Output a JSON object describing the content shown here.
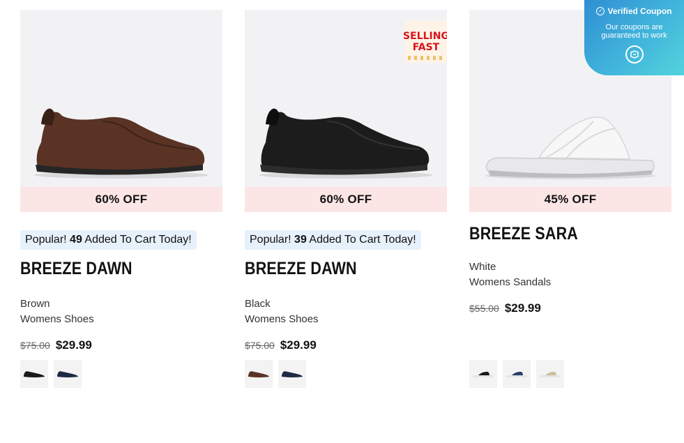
{
  "coupon": {
    "title": "Verified Coupon",
    "subtitle_line1": "Our coupons are",
    "subtitle_line2": "guaranteed to work",
    "check_icon": "check-circle-icon",
    "logo_icon": "coupon-logo-icon"
  },
  "products": [
    {
      "discount": "60% OFF",
      "popular_prefix": "Popular!",
      "popular_count": "49",
      "popular_suffix": "Added To Cart Today!",
      "name": "BREEZE DAWN",
      "color": "Brown",
      "category": "Womens Shoes",
      "old_price": "$75.00",
      "new_price": "$29.99",
      "shoe_color": "#5a3324",
      "swatches": [
        "black",
        "navy"
      ]
    },
    {
      "discount": "60% OFF",
      "popular_prefix": "Popular!",
      "popular_count": "39",
      "popular_suffix": "Added To Cart Today!",
      "name": "BREEZE DAWN",
      "color": "Black",
      "category": "Womens Shoes",
      "old_price": "$75.00",
      "new_price": "$29.99",
      "shoe_color": "#1c1c1c",
      "badge_line1": "SELLING",
      "badge_line2": "FAST",
      "swatches": [
        "brown",
        "navy"
      ]
    },
    {
      "discount": "45% OFF",
      "name": "BREEZE SARA",
      "color": "White",
      "category": "Womens Sandals",
      "old_price": "$55.00",
      "new_price": "$29.99",
      "shoe_color": "#f5f5f5",
      "swatches": [
        "black",
        "navy",
        "sand"
      ]
    }
  ]
}
